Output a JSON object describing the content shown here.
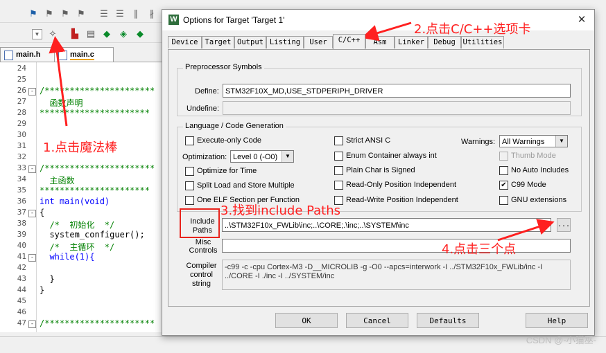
{
  "ide": {
    "file_tabs": [
      "main.h",
      "main.c"
    ],
    "lines": [
      {
        "n": "24",
        "text": ""
      },
      {
        "n": "25",
        "text": ""
      },
      {
        "n": "26",
        "text": "/**********************",
        "cls": "cm",
        "fold": "-"
      },
      {
        "n": "27",
        "text": "  函数声明",
        "cls": "cm"
      },
      {
        "n": "28",
        "text": "**********************",
        "cls": "cm"
      },
      {
        "n": "29",
        "text": ""
      },
      {
        "n": "30",
        "text": ""
      },
      {
        "n": "31",
        "text": ""
      },
      {
        "n": "32",
        "text": ""
      },
      {
        "n": "33",
        "text": "/**********************",
        "cls": "cm",
        "fold": "-"
      },
      {
        "n": "34",
        "text": "  主函数",
        "cls": "cm"
      },
      {
        "n": "35",
        "text": "**********************",
        "cls": "cm"
      },
      {
        "n": "36",
        "text": "int main(void)",
        "cls": "mix"
      },
      {
        "n": "37",
        "text": "{",
        "fold": "-"
      },
      {
        "n": "38",
        "text": "  /*  初始化  */",
        "cls": "cm"
      },
      {
        "n": "39",
        "text": "  system_configuer();"
      },
      {
        "n": "40",
        "text": "  /*  主循环  */",
        "cls": "cm"
      },
      {
        "n": "41",
        "text": "  while(1){",
        "cls": "kwl",
        "fold": "-"
      },
      {
        "n": "42",
        "text": ""
      },
      {
        "n": "43",
        "text": "  }"
      },
      {
        "n": "44",
        "text": "}"
      },
      {
        "n": "45",
        "text": ""
      },
      {
        "n": "46",
        "text": ""
      },
      {
        "n": "47",
        "text": "/**********************",
        "cls": "cm",
        "fold": "-"
      }
    ]
  },
  "dialog": {
    "title": "Options for Target 'Target 1'",
    "close_glyph": "✕",
    "tabs": [
      "Device",
      "Target",
      "Output",
      "Listing",
      "User",
      "C/C++",
      "Asm",
      "Linker",
      "Debug",
      "Utilities"
    ],
    "active_tab": "C/C++",
    "preprocessor": {
      "group_label": "Preprocessor Symbols",
      "define_label": "Define:",
      "define_value": "STM32F10X_MD,USE_STDPERIPH_DRIVER",
      "undefine_label": "Undefine:",
      "undefine_value": ""
    },
    "language": {
      "group_label": "Language / Code Generation",
      "execute_only": "Execute-only Code",
      "optimization_label": "Optimization:",
      "optimization_value": "Level 0 (-O0)",
      "optimize_time": "Optimize for Time",
      "split_load": "Split Load and Store Multiple",
      "one_elf": "One ELF Section per Function",
      "strict_ansi": "Strict ANSI C",
      "enum_container": "Enum Container always int",
      "plain_char": "Plain Char is Signed",
      "ro_pi": "Read-Only Position Independent",
      "rw_pi": "Read-Write Position Independent",
      "warnings_label": "Warnings:",
      "warnings_value": "All Warnings",
      "thumb_mode": "Thumb Mode",
      "no_auto_includes": "No Auto Includes",
      "c99_mode": "C99 Mode",
      "gnu_ext": "GNU extensions",
      "c99_checked": "✔"
    },
    "include_label_1": "Include",
    "include_label_2": "Paths",
    "include_value": "..\\STM32F10x_FWLib\\inc;..\\CORE;.\\inc;..\\SYSTEM\\inc",
    "browse_label": "...",
    "misc_label_1": "Misc",
    "misc_label_2": "Controls",
    "misc_value": "",
    "compiler_label_1": "Compiler",
    "compiler_label_2": "control",
    "compiler_label_3": "string",
    "compiler_line_1": "-c99 -c -cpu Cortex-M3 -D__MICROLIB -g -O0 --apcs=interwork -I ../STM32F10x_FWLib/inc -I",
    "compiler_line_2": "../CORE -I ./inc -I ../SYSTEM/inc",
    "buttons": {
      "ok": "OK",
      "cancel": "Cancel",
      "defaults": "Defaults",
      "help": "Help"
    }
  },
  "annotations": {
    "step1": "1.点击魔法棒",
    "step2": "2.点击C/C++选项卡",
    "step3": "3.找到include Paths",
    "step4": "4.点击三个点"
  },
  "watermark": "CSDN @-小猫巫-",
  "colors": {
    "annotation": "#ff2020",
    "comment": "#008000",
    "keyword": "#0000ff"
  }
}
